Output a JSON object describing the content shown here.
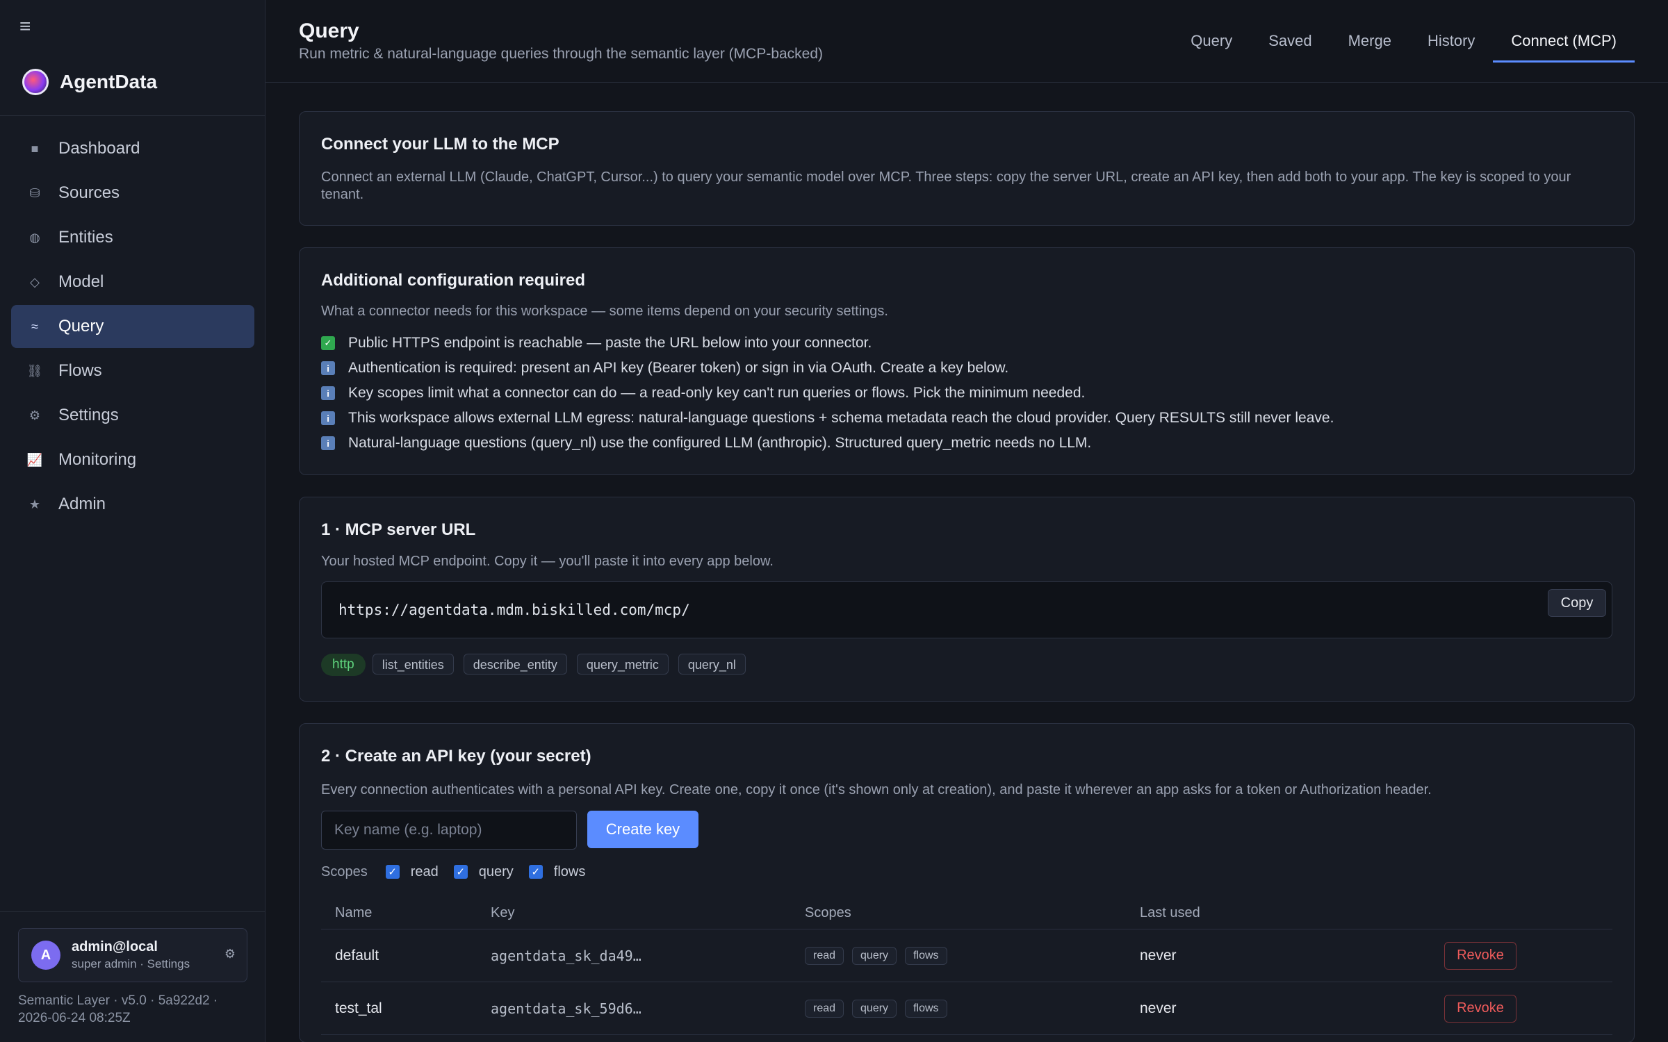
{
  "app": {
    "name": "AgentData"
  },
  "sidebar": {
    "items": [
      {
        "label": "Dashboard",
        "icon": "dashboard-icon",
        "glyph": "■"
      },
      {
        "label": "Sources",
        "icon": "database-icon",
        "glyph": "⛁"
      },
      {
        "label": "Entities",
        "icon": "entities-icon",
        "glyph": "◍"
      },
      {
        "label": "Model",
        "icon": "model-icon",
        "glyph": "◇"
      },
      {
        "label": "Query",
        "icon": "query-icon",
        "glyph": "≈",
        "active": true
      },
      {
        "label": "Flows",
        "icon": "flows-icon",
        "glyph": "⛓"
      },
      {
        "label": "Settings",
        "icon": "gear-icon",
        "glyph": "⚙"
      },
      {
        "label": "Monitoring",
        "icon": "chart-icon",
        "glyph": "📈"
      },
      {
        "label": "Admin",
        "icon": "star-icon",
        "glyph": "★"
      }
    ],
    "user": {
      "initial": "A",
      "name": "admin@local",
      "role": "super admin · Settings"
    },
    "version": "Semantic Layer · v5.0 · 5a922d2 · 2026-06-24 08:25Z"
  },
  "header": {
    "title": "Query",
    "subtitle": "Run metric & natural-language queries through the semantic layer (MCP-backed)",
    "tabs": [
      "Query",
      "Saved",
      "Merge",
      "History",
      "Connect (MCP)"
    ],
    "active_tab": "Connect (MCP)"
  },
  "connect_card": {
    "title": "Connect your LLM to the MCP",
    "description": "Connect an external LLM (Claude, ChatGPT, Cursor...) to query your semantic model over MCP. Three steps: copy the server URL, create an API key, then add both to your app. The key is scoped to your tenant."
  },
  "config_card": {
    "title": "Additional configuration required",
    "description": "What a connector needs for this workspace — some items depend on your security settings.",
    "items": [
      {
        "status": "ok",
        "text": "Public HTTPS endpoint is reachable — paste the URL below into your connector."
      },
      {
        "status": "info",
        "text": "Authentication is required: present an API key (Bearer token) or sign in via OAuth. Create a key below."
      },
      {
        "status": "info",
        "text": "Key scopes limit what a connector can do — a read-only key can't run queries or flows. Pick the minimum needed."
      },
      {
        "status": "info",
        "text": "This workspace allows external LLM egress: natural-language questions + schema metadata reach the cloud provider. Query RESULTS still never leave."
      },
      {
        "status": "info",
        "text": "Natural-language questions (query_nl) use the configured LLM (anthropic). Structured query_metric needs no LLM."
      }
    ]
  },
  "server_card": {
    "title": "1 · MCP server URL",
    "description": "Your hosted MCP endpoint. Copy it — you'll paste it into every app below.",
    "url": "https://agentdata.mdm.biskilled.com/mcp/",
    "copy_label": "Copy",
    "transport": "http",
    "tools": [
      "list_entities",
      "describe_entity",
      "query_metric",
      "query_nl"
    ]
  },
  "apikey_card": {
    "title": "2 · Create an API key (your secret)",
    "description": "Every connection authenticates with a personal API key. Create one, copy it once (it's shown only at creation), and paste it wherever an app asks for a token or Authorization header.",
    "input_placeholder": "Key name (e.g. laptop)",
    "create_label": "Create key",
    "scopes_label": "Scopes",
    "scopes": [
      {
        "label": "read",
        "checked": true
      },
      {
        "label": "query",
        "checked": true
      },
      {
        "label": "flows",
        "checked": true
      }
    ],
    "table": {
      "headers": [
        "Name",
        "Key",
        "Scopes",
        "Last used"
      ],
      "rows": [
        {
          "name": "default",
          "key": "agentdata_sk_da49…",
          "scopes": [
            "read",
            "query",
            "flows"
          ],
          "last_used": "never",
          "action": "Revoke"
        },
        {
          "name": "test_tal",
          "key": "agentdata_sk_59d6…",
          "scopes": [
            "read",
            "query",
            "flows"
          ],
          "last_used": "never",
          "action": "Revoke"
        }
      ]
    }
  },
  "colors": {
    "accent": "#5b8cff",
    "active_nav": "#2b3a5e",
    "danger": "#ef5b5b",
    "success": "#2fa84f"
  }
}
